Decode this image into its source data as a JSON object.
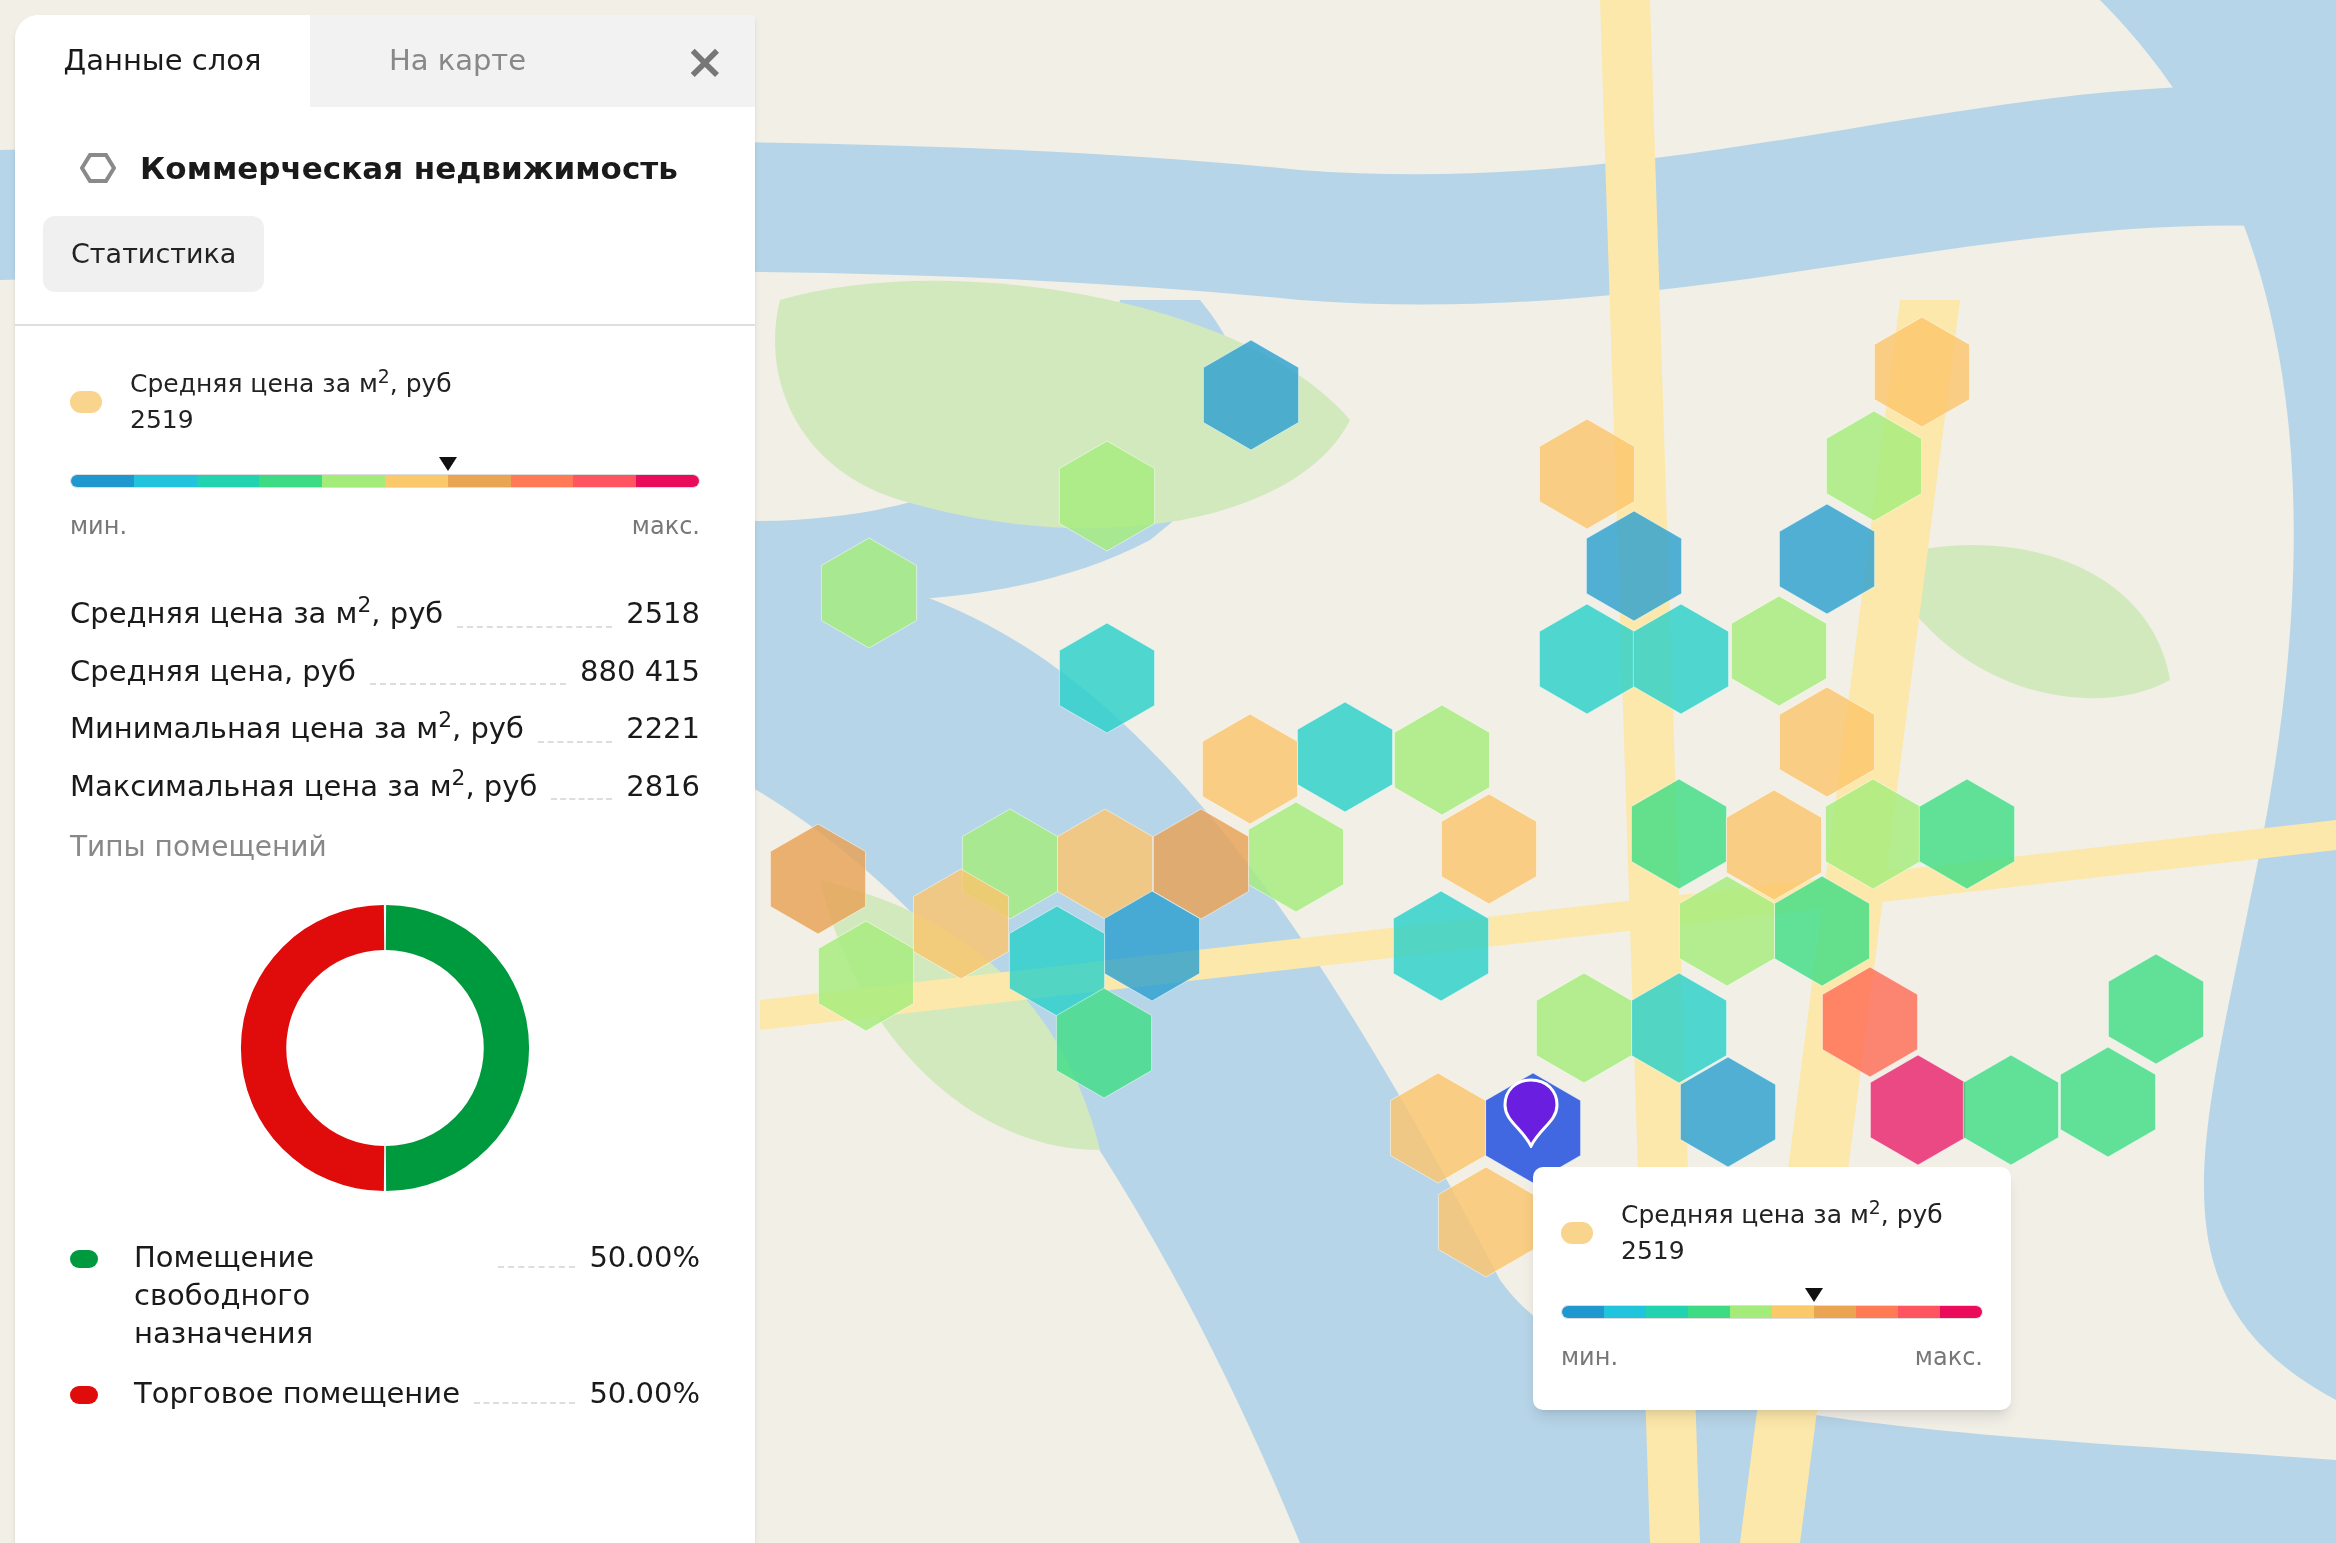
{
  "panel": {
    "tabs": [
      {
        "label": "Данные слоя",
        "selected": true
      },
      {
        "label": "На карте",
        "selected": false
      }
    ],
    "close_icon": "×",
    "layer_title": "Коммерческая недвижимость",
    "statistics_button": "Статистика",
    "legend": {
      "label": "Средняя цена за м$^{2}$, руб",
      "value": "2519",
      "color": "#f8d48c",
      "level": 0.6,
      "min_label": "мин.",
      "max_label": "макс."
    },
    "stats": [
      {
        "label": "Средняя цена за м$^{2}$, руб",
        "value": "2518"
      },
      {
        "label": "Средняя цена, руб",
        "value": "880 415"
      },
      {
        "label": "Минимальная цена за м$^{2}$, руб",
        "value": "2221"
      },
      {
        "label": "Максимальная цена за м$^{2}$, руб",
        "value": "2816"
      }
    ],
    "chart_data": {
      "type": "donut",
      "categories": [
        "Помещение свободного назначения",
        "Торговое помещение"
      ],
      "series": [
        {
          "name": "Типы помещений",
          "values": [
            50,
            50
          ]
        }
      ]
    },
    "types": [
      {
        "value": "50.00%",
        "color": "#009a3e"
      },
      {
        "value": "50.00%",
        "color": "#e00b0b"
      }
    ]
  },
  "tooltip": {
    "label": "Средняя цена за м$^{2}$, руб",
    "value": "2519",
    "color": "#f8d48c",
    "level": 0.6,
    "min_label": "мин.",
    "max_label": "макс."
  }
}
